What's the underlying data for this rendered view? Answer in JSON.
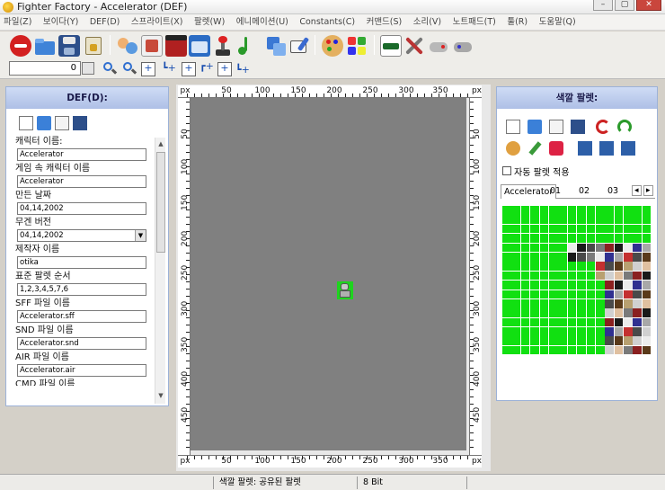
{
  "window": {
    "title": "Fighter Factory - Accelerator (DEF)"
  },
  "menu": [
    "파일(Z)",
    "보이다(Y)",
    "DEF(D)",
    "스프라이트(X)",
    "팔렛(W)",
    "에니메이션(U)",
    "Constants(C)",
    "커맨드(S)",
    "소리(V)",
    "노트패드(T)",
    "툴(R)",
    "도움말(Q)"
  ],
  "toolbar2": {
    "frame_value": "0"
  },
  "def_panel": {
    "header": "DEF(D):",
    "fields": [
      {
        "label": "캐릭터 이름:",
        "value": "Accelerator"
      },
      {
        "label": "게임 속 캐릭터 이름",
        "value": "Accelerator"
      },
      {
        "label": "만든 날짜",
        "value": "04,14,2002"
      },
      {
        "label": "무겐 버전",
        "value": "04,14,2002",
        "combo": true
      },
      {
        "label": "제작자 이름",
        "value": "otika"
      },
      {
        "label": "표준 팔렛 순서",
        "value": "1,2,3,4,5,7,6"
      },
      {
        "label": "SFF 파일 이름",
        "value": "Accelerator.sff"
      },
      {
        "label": "SND 파일 이름",
        "value": "Accelerator.snd"
      },
      {
        "label": "AIR 파일 이름",
        "value": "Accelerator.air"
      },
      {
        "label": "CMD 파일 이름",
        "value": ""
      }
    ]
  },
  "ruler": {
    "unit": "px",
    "h_labels": [
      "50",
      "100",
      "150",
      "200",
      "250",
      "300",
      "350"
    ],
    "v_labels": [
      "50",
      "100",
      "150",
      "200",
      "250",
      "300",
      "350",
      "400",
      "450"
    ]
  },
  "palette_panel": {
    "header": "색깔 팔렛:",
    "auto_apply_label": "자동 팔렛 적용",
    "tabs": [
      "Accelerator",
      "01",
      "02",
      "03"
    ],
    "tab_nav": [
      "◂",
      "▸"
    ]
  },
  "status": {
    "palette": "색깔 팔렛: 공유된 팔렛",
    "depth": "8 Bit"
  },
  "colors": {
    "green": "#11e011",
    "canvas": "#808080",
    "panel_header": "#c3d2f0"
  }
}
